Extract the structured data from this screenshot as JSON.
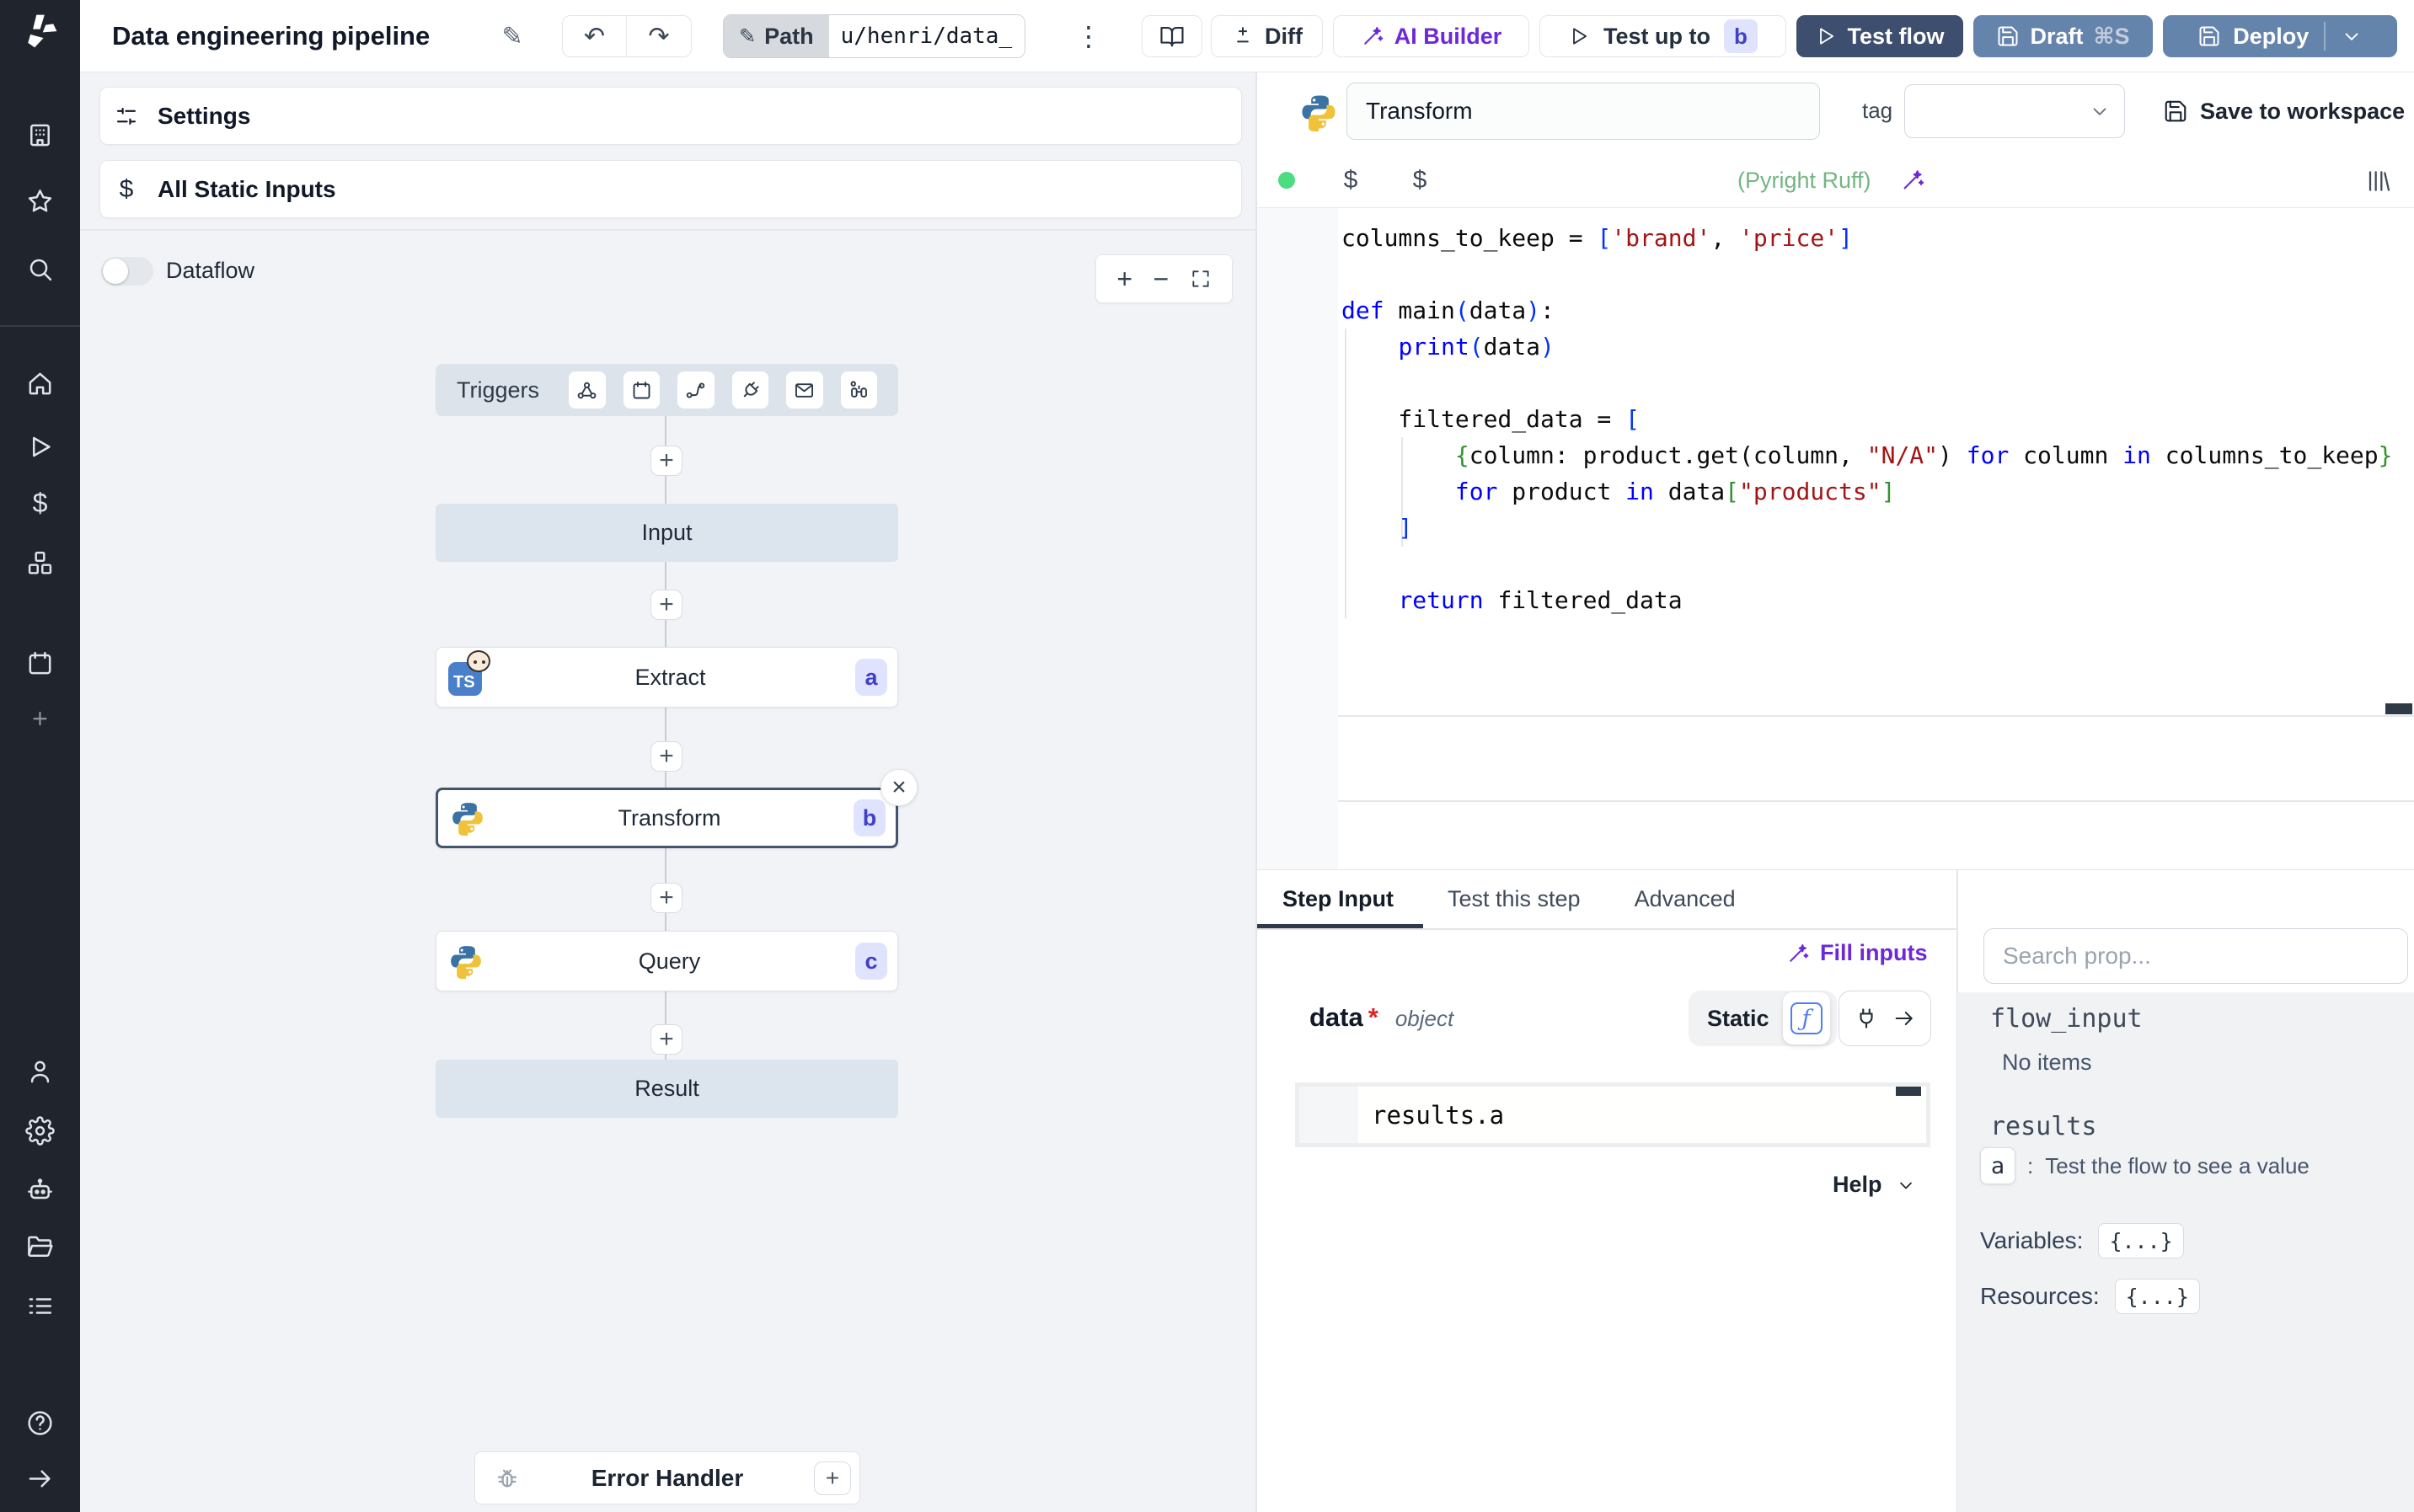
{
  "colors": {
    "accent_purple": "#6d28d9",
    "primary_dark_button": "#3d4e6e",
    "steel_blue_button": "#6584ac",
    "badge_bg": "#dfe3fd",
    "badge_text": "#4040c8",
    "lint_green": "#74b584",
    "status_dot_green": "#4ade80",
    "function_blue": "#4f7df9",
    "sidebar_bg": "#20242c",
    "canvas_bg": "#f1f3f6",
    "node_bar_bg": "#dce4ee"
  },
  "icons": {
    "sidebar": [
      "windmill-logo",
      "workspace",
      "favorites",
      "search",
      "home",
      "runs",
      "variables",
      "resources",
      "schedules",
      "add",
      "user",
      "settings",
      "workers",
      "folders",
      "logs",
      "help",
      "collapse"
    ],
    "triggers": [
      "webhook",
      "schedule",
      "route",
      "websocket",
      "email",
      "poll"
    ]
  },
  "topbar": {
    "title": "Data engineering pipeline",
    "path_label": "Path",
    "path_value": "u/henri/data_",
    "diff_label": "Diff",
    "ai_builder_label": "AI Builder",
    "test_up_to_label": "Test up to",
    "test_up_to_badge": "b",
    "test_flow_label": "Test flow",
    "draft_label": "Draft",
    "draft_shortcut": "⌘S",
    "deploy_label": "Deploy"
  },
  "flow_panel": {
    "settings_label": "Settings",
    "all_static_inputs_label": "All Static Inputs",
    "dataflow_label": "Dataflow",
    "triggers_label": "Triggers",
    "input_node": "Input",
    "result_node": "Result",
    "error_handler_label": "Error Handler",
    "nodes": [
      {
        "label": "Extract",
        "badge": "a",
        "language": "bun"
      },
      {
        "label": "Transform",
        "badge": "b",
        "language": "python",
        "selected": true
      },
      {
        "label": "Query",
        "badge": "c",
        "language": "python"
      }
    ]
  },
  "editor_panel": {
    "step_name": "Transform",
    "tag_label": "tag",
    "save_button": "Save to workspace",
    "lint_status": "(Pyright Ruff)",
    "code_lines": [
      [
        {
          "t": "columns_to_keep = ",
          "c": "p"
        },
        {
          "t": "[",
          "c": "b1"
        },
        {
          "t": "'brand'",
          "c": "s"
        },
        {
          "t": ", ",
          "c": "p"
        },
        {
          "t": "'price'",
          "c": "s"
        },
        {
          "t": "]",
          "c": "b1"
        }
      ],
      [],
      [
        {
          "t": "def",
          "c": "k"
        },
        {
          "t": " main",
          "c": "p"
        },
        {
          "t": "(",
          "c": "b1"
        },
        {
          "t": "data",
          "c": "p"
        },
        {
          "t": ")",
          "c": "b1"
        },
        {
          "t": ":",
          "c": "p"
        }
      ],
      [
        {
          "t": "    ",
          "c": "p"
        },
        {
          "t": "print",
          "c": "k"
        },
        {
          "t": "(",
          "c": "b1"
        },
        {
          "t": "data",
          "c": "p"
        },
        {
          "t": ")",
          "c": "b1"
        }
      ],
      [],
      [
        {
          "t": "    filtered_data = ",
          "c": "p"
        },
        {
          "t": "[",
          "c": "b1"
        }
      ],
      [
        {
          "t": "        ",
          "c": "p"
        },
        {
          "t": "{",
          "c": "b2"
        },
        {
          "t": "column: product.get(column, ",
          "c": "p"
        },
        {
          "t": "\"N/A\"",
          "c": "s"
        },
        {
          "t": ") ",
          "c": "p"
        },
        {
          "t": "for",
          "c": "k"
        },
        {
          "t": " column ",
          "c": "p"
        },
        {
          "t": "in",
          "c": "k"
        },
        {
          "t": " columns_to_keep",
          "c": "p"
        },
        {
          "t": "}",
          "c": "b2"
        }
      ],
      [
        {
          "t": "        ",
          "c": "p"
        },
        {
          "t": "for",
          "c": "k"
        },
        {
          "t": " product ",
          "c": "p"
        },
        {
          "t": "in",
          "c": "k"
        },
        {
          "t": " data",
          "c": "p"
        },
        {
          "t": "[",
          "c": "b2"
        },
        {
          "t": "\"products\"",
          "c": "s"
        },
        {
          "t": "]",
          "c": "b2"
        }
      ],
      [
        {
          "t": "    ",
          "c": "p"
        },
        {
          "t": "]",
          "c": "b1"
        }
      ],
      [],
      [
        {
          "t": "    ",
          "c": "p"
        },
        {
          "t": "return",
          "c": "k"
        },
        {
          "t": " filtered_data",
          "c": "p"
        }
      ]
    ]
  },
  "step_panel": {
    "tabs": [
      "Step Input",
      "Test this step",
      "Advanced"
    ],
    "active_tab": "Step Input",
    "fill_inputs_label": "Fill inputs",
    "arg_name": "data",
    "arg_required_marker": "*",
    "arg_type": "object",
    "static_toggle_label": "Static",
    "expression": "results.a",
    "help_label": "Help"
  },
  "props_panel": {
    "search_placeholder": "Search prop...",
    "flow_input_label": "flow_input",
    "flow_input_empty": "No items",
    "results_label": "results",
    "result_key": "a",
    "result_separator": ":",
    "result_hint": "Test the flow to see a value",
    "variables_label": "Variables:",
    "variables_value": "{...}",
    "resources_label": "Resources:",
    "resources_value": "{...}"
  }
}
